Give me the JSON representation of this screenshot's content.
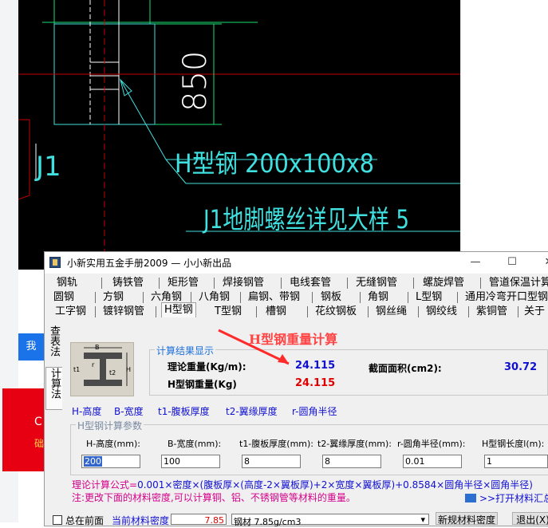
{
  "cad": {
    "dimension_text": "850",
    "label_j1": "J1",
    "label_h_beam": "H型钢 200x100x8",
    "label_anchor": "J1地脚螺丝详见大样 5"
  },
  "background_page": {
    "blue_button_text": "我",
    "red_card_text_1": "C",
    "red_card_text_2": "础"
  },
  "window": {
    "title": "小新实用五金手册2009 — 小小新出品",
    "controls": {
      "minimize": "—",
      "maximize": "☐",
      "close": "✕"
    },
    "tabs_row1": [
      "钢轨",
      "铸铁管",
      "矩形管",
      "焊接钢管",
      "电线套管",
      "无缝钢管",
      "螺旋焊管",
      "管道保温计算"
    ],
    "tabs_row2": [
      "圆钢",
      "方钢",
      "六角钢",
      "八角钢",
      "扁钢、带钢",
      "钢板",
      "角钢",
      "L型钢",
      "通用冷弯开口型钢"
    ],
    "tabs_row3": [
      "工字钢",
      "镀锌钢管",
      "H型钢",
      "T型钢",
      "槽钢",
      "花纹钢板",
      "钢丝绳",
      "钢绞线",
      "紫铜管",
      "关于"
    ],
    "active_tab": "H型钢",
    "vertical_tabs": [
      "查表法",
      "计算法"
    ],
    "diagram_labels": {
      "B": "B",
      "t1": "t1",
      "t2": "t2",
      "H": "H",
      "r": "r"
    },
    "results": {
      "group_title": "计算结果显示",
      "theoretical_weight_label": "理论重量(Kg/m):",
      "theoretical_weight_value": "24.115",
      "total_weight_label": "H型钢重量(Kg)",
      "total_weight_value": "24.115",
      "section_area_label": "截面面积(cm2):",
      "section_area_value": "30.72"
    },
    "legend": {
      "h": "H-高度",
      "b": "B-宽度",
      "t1": "t1-腹板厚度",
      "t2": "t2-翼缘厚度",
      "r": "r-圆角半径"
    },
    "params": {
      "group_title": "H型钢计算参数",
      "fields": [
        {
          "label": "H-高度(mm):",
          "value": "200"
        },
        {
          "label": "B-宽度(mm):",
          "value": "100"
        },
        {
          "label": "t1-腹板厚度(mm):",
          "value": "8"
        },
        {
          "label": "t2-翼缘厚度(mm):",
          "value": "8"
        },
        {
          "label": "r-圆角半径(mm):",
          "value": "0.01"
        },
        {
          "label": "H型钢长度l(m):",
          "value": "1"
        }
      ]
    },
    "formula_label": "理论计算公式=",
    "formula": "0.001×密度×(腹板厚×(高度-2×翼板厚)+2×宽度×翼板厚)+0.8584×圆角半径×圆角半径)",
    "note": "注:更改下面的材料密度,可以计算铜、铝、不锈钢管等材料的重量。",
    "open_library": ">>打开材料汇总",
    "bottom": {
      "always_on_top": "总在前面",
      "density_label": "当前材料密度",
      "density_value": "7.85",
      "material_select": "钢材 7.85g/cm3",
      "new_density_button": "新规材料密度",
      "exit_button": "退出(X)"
    }
  },
  "annotation": "H型钢重量计算",
  "colors": {
    "cad_green": "#18e070",
    "cad_cyan": "#40e0e0",
    "cad_red": "#c00000",
    "value_blue": "#1010d0",
    "value_red": "#e00000",
    "formula_magenta": "#d4008a",
    "annotation_red": "#ff4444"
  }
}
